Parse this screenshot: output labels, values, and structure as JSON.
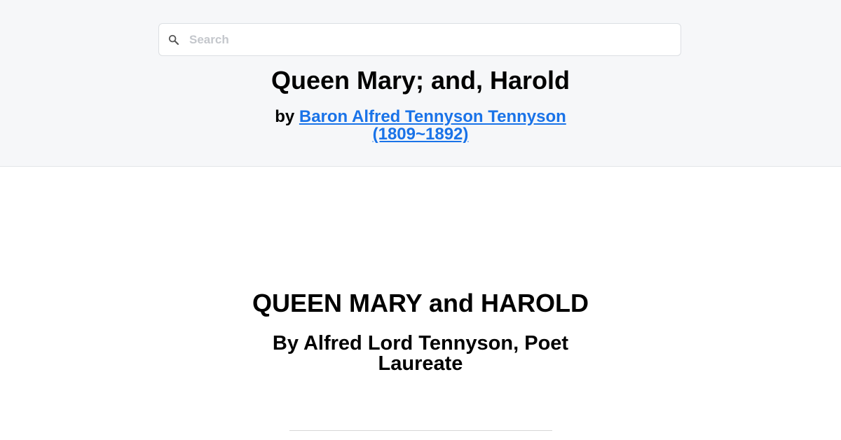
{
  "search": {
    "placeholder": "Search",
    "value": "",
    "icon": "search-icon"
  },
  "header": {
    "title": "Queen Mary; and, Harold",
    "by_label": "by",
    "author_link": "Baron Alfred Tennyson Tennyson (1809~1892)"
  },
  "content": {
    "book_title": "QUEEN MARY and HAROLD",
    "book_subtitle": "By Alfred Lord Tennyson, Poet Laureate"
  },
  "colors": {
    "header_background": "#f6f7f9",
    "link": "#1a73e8",
    "text": "#000000"
  }
}
